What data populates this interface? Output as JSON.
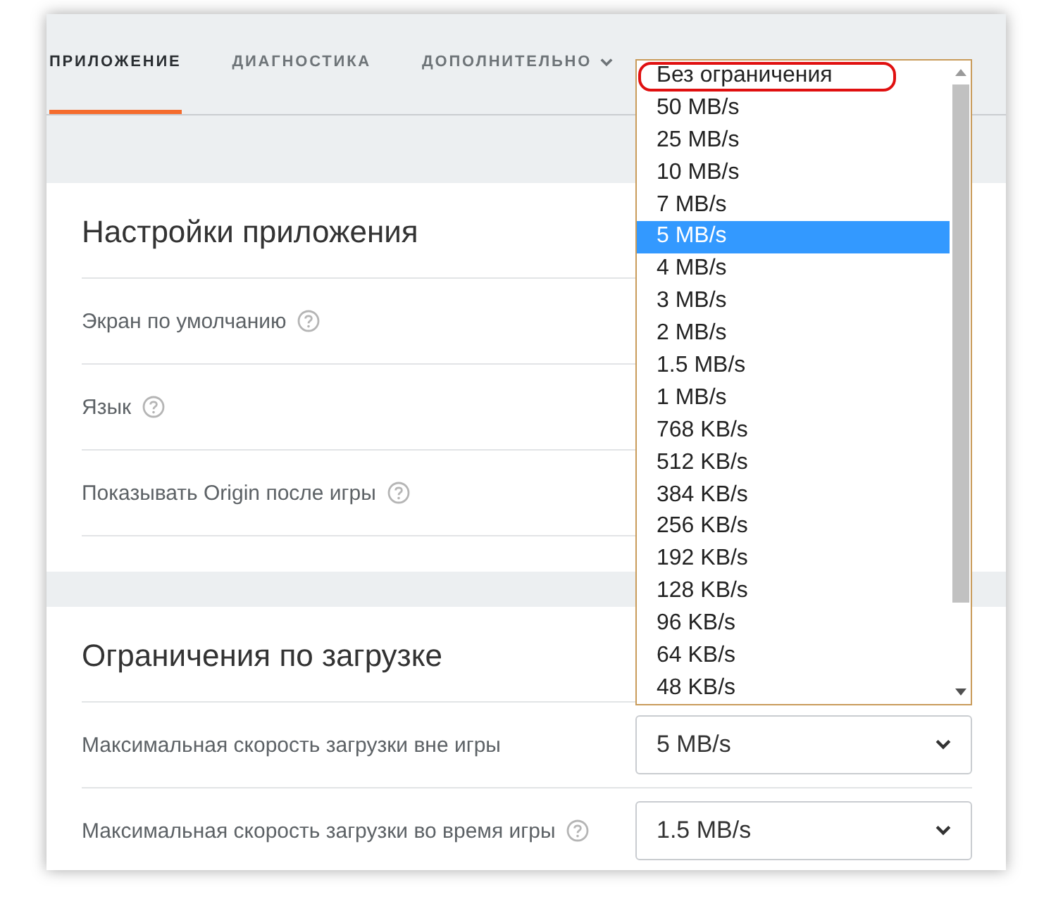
{
  "tabs": [
    {
      "label": "ПРИЛОЖЕНИЕ",
      "selected": true,
      "menu": false
    },
    {
      "label": "ДИАГНОСТИКА",
      "selected": false,
      "menu": false
    },
    {
      "label": "ДОПОЛНИТЕЛЬНО",
      "selected": false,
      "menu": true
    }
  ],
  "sections": [
    {
      "title": "Настройки приложения",
      "rows": [
        {
          "label": "Экран по умолчанию",
          "help": true
        },
        {
          "label": "Язык",
          "help": true
        },
        {
          "label": "Показывать Origin после игры",
          "help": true
        }
      ]
    },
    {
      "title": "Ограничения по загрузке",
      "rows": [
        {
          "label": "Максимальная скорость загрузки вне игры",
          "help": false,
          "value": "5 MB/s"
        },
        {
          "label": "Максимальная скорость загрузки во время игры",
          "help": true,
          "value": "1.5 MB/s"
        }
      ]
    }
  ],
  "dropdown_list": {
    "options": [
      {
        "label": "Без ограничения",
        "selected": false,
        "circled": true
      },
      {
        "label": "50 MB/s",
        "selected": false,
        "circled": false
      },
      {
        "label": "25 MB/s",
        "selected": false,
        "circled": false
      },
      {
        "label": "10 MB/s",
        "selected": false,
        "circled": false
      },
      {
        "label": "7 MB/s",
        "selected": false,
        "circled": false
      },
      {
        "label": "5 MB/s",
        "selected": true,
        "circled": false
      },
      {
        "label": "4 MB/s",
        "selected": false,
        "circled": false
      },
      {
        "label": "3 MB/s",
        "selected": false,
        "circled": false
      },
      {
        "label": "2 MB/s",
        "selected": false,
        "circled": false
      },
      {
        "label": "1.5 MB/s",
        "selected": false,
        "circled": false
      },
      {
        "label": "1 MB/s",
        "selected": false,
        "circled": false
      },
      {
        "label": "768 KB/s",
        "selected": false,
        "circled": false
      },
      {
        "label": "512 KB/s",
        "selected": false,
        "circled": false
      },
      {
        "label": "384 KB/s",
        "selected": false,
        "circled": false
      },
      {
        "label": "256 KB/s",
        "selected": false,
        "circled": false
      },
      {
        "label": "192 KB/s",
        "selected": false,
        "circled": false
      },
      {
        "label": "128 KB/s",
        "selected": false,
        "circled": false
      },
      {
        "label": "96 KB/s",
        "selected": false,
        "circled": false
      },
      {
        "label": "64 KB/s",
        "selected": false,
        "circled": false
      },
      {
        "label": "48 KB/s",
        "selected": false,
        "circled": false
      }
    ]
  }
}
